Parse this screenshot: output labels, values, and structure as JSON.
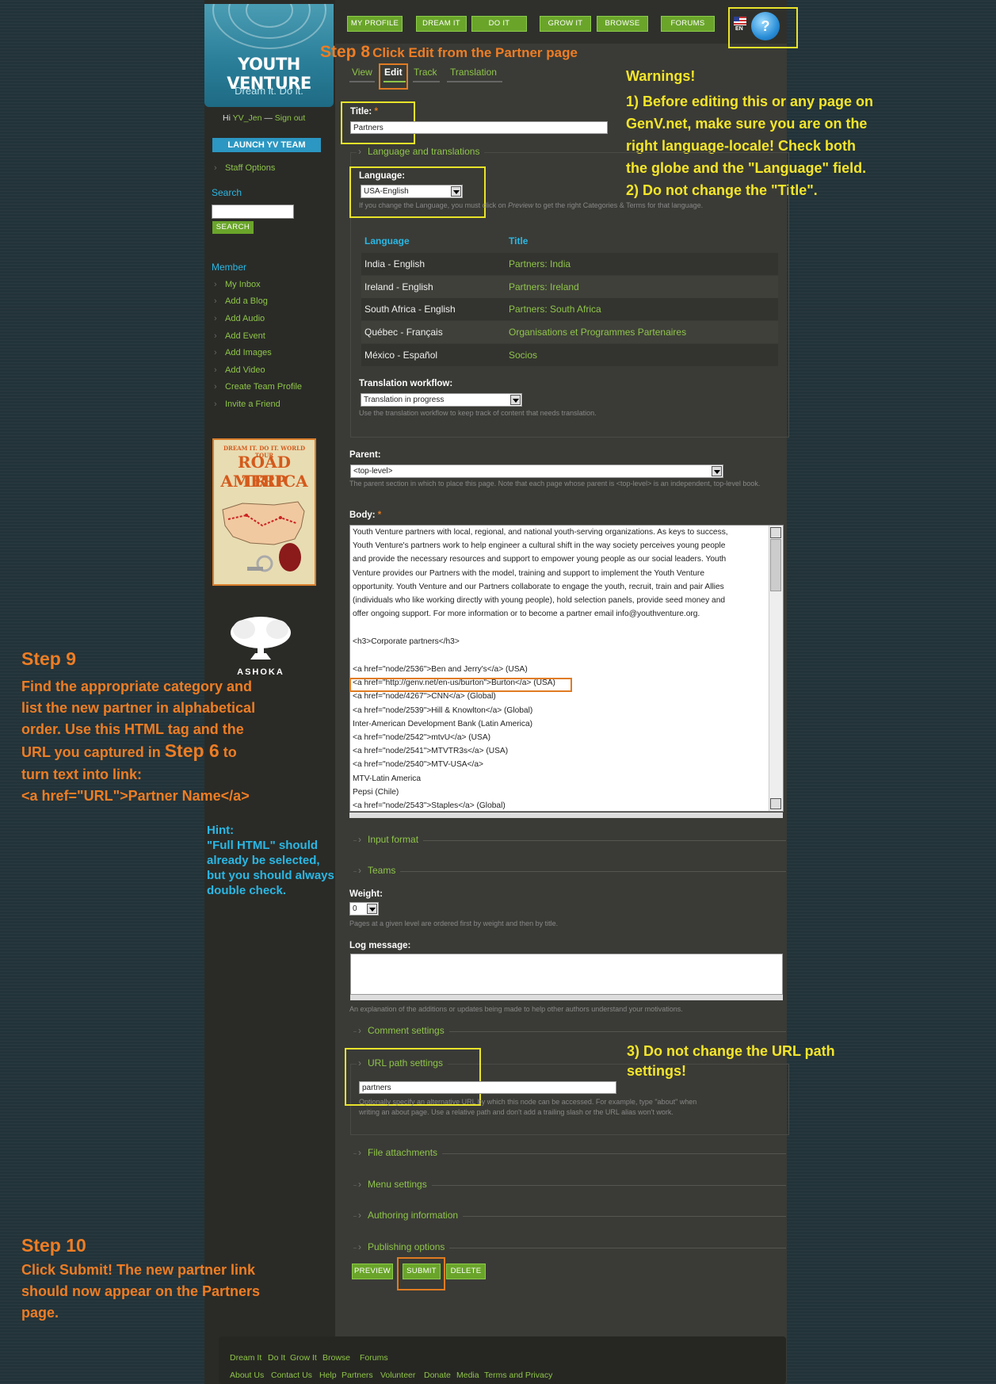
{
  "nav": {
    "buttons": [
      "MY PROFILE",
      "DREAM IT",
      "DO IT",
      "GROW IT",
      "BROWSE",
      "FORUMS"
    ],
    "lang_code": "EN",
    "help_symbol": "?"
  },
  "logo": {
    "title": "YOUTH VENTURE",
    "tagline": "Dream it. Do it."
  },
  "sidebar": {
    "greeting_prefix": "Hi",
    "username": "YV_Jen",
    "separator": "—",
    "signout": "Sign out",
    "launch_label": "LAUNCH YV TEAM",
    "staff_options": "Staff Options",
    "search_heading": "Search",
    "search_button": "SEARCH",
    "member_heading": "Member",
    "member_links": [
      "My Inbox",
      "Add a Blog",
      "Add Audio",
      "Add Event",
      "Add Images",
      "Add Video",
      "Create Team Profile",
      "Invite a Friend"
    ],
    "promo": {
      "top": "DREAM IT. DO IT. WORLD TOUR",
      "line1": "ROAD TRIP",
      "line2": "AMERICA"
    },
    "ashoka": "ASHOKA"
  },
  "tabs": [
    "View",
    "Edit",
    "Track",
    "Translation"
  ],
  "form": {
    "title_label": "Title:",
    "required_mark": "*",
    "title_value": "Partners",
    "lang_fieldset": "Language and translations",
    "language_label": "Language:",
    "language_value": "USA-English",
    "language_hint_a": "If you change the Language, you must click on",
    "language_hint_em": "Preview",
    "language_hint_b": "to get the right Categories & Terms for that language.",
    "translations": {
      "headers": [
        "Language",
        "Title"
      ],
      "rows": [
        [
          "India - English",
          "Partners: India"
        ],
        [
          "Ireland - English",
          "Partners: Ireland"
        ],
        [
          "South Africa - English",
          "Partners: South Africa"
        ],
        [
          "Québec - Français",
          "Organisations et Programmes Partenaires"
        ],
        [
          "México - Español",
          "Socios"
        ]
      ]
    },
    "workflow_label": "Translation workflow:",
    "workflow_value": "Translation in progress",
    "workflow_hint": "Use the translation workflow to keep track of content that needs translation.",
    "parent_label": "Parent:",
    "parent_value": "<top-level>",
    "parent_hint": "The parent section in which to place this page. Note that each page whose parent is <top-level> is an independent, top-level book.",
    "body_label": "Body:",
    "body_lines": [
      "Youth Venture partners with local, regional, and national youth-serving organizations.  As keys to success,",
      "Youth Venture's partners work to help engineer a cultural shift in the way society perceives young people",
      "and provide the necessary resources and support to empower young people as our social leaders.  Youth",
      "Venture provides our Partners with the model, training and support to implement the Youth Venture",
      "opportunity. Youth Venture and our Partners collaborate to engage the youth, recruit, train and pair Allies",
      "(individuals who like working directly with young people), hold selection panels, provide seed money and",
      "offer ongoing support.  For more information or to become a partner email info@youthventure.org.",
      "",
      "<h3>Corporate partners</h3>",
      "",
      "<a href=\"node/2536\">Ben and Jerry's</a> (USA)",
      "<a href=\"http://genv.net/en-us/burton\">Burton</a> (USA)",
      "<a href=\"node/4267\">CNN</a> (Global)",
      "<a href=\"node/2539\">Hill & Knowlton</a> (Global)",
      "Inter-American Development Bank (Latin America)",
      "<a href=\"node/2542\">mtvU</a> (USA)",
      "<a href=\"node/2541\">MTVTR3s</a> (USA)",
      "<a href=\"node/2540\">MTV-USA</a>",
      "MTV-Latin America",
      "Pepsi (Chile)",
      "<a href=\"node/2543\">Staples</a> (Global)"
    ],
    "input_format": "Input format",
    "teams": "Teams",
    "weight_label": "Weight:",
    "weight_value": "0",
    "weight_hint": "Pages at a given level are ordered first by weight and then by title.",
    "log_label": "Log message:",
    "log_value": "",
    "log_hint": "An explanation of the additions or updates being made to help other authors understand your motivations.",
    "comment_settings": "Comment settings",
    "url_fieldset": "URL path settings",
    "url_value": "partners",
    "url_hint_1": "Optionally specify an alternative URL by which this node can be accessed. For example, type \"about\" when",
    "url_hint_2": "writing an about page. Use a relative path and don't add a trailing slash or the URL alias won't work.",
    "collapsed": [
      "File attachments",
      "Menu settings",
      "Authoring information",
      "Publishing options"
    ],
    "buttons": {
      "preview": "PREVIEW",
      "submit": "SUBMIT",
      "delete": "DELETE"
    }
  },
  "annotations": {
    "step8_num": "Step 8",
    "step8_text": "Click Edit from the Partner page",
    "warn_title": "Warnings!",
    "warn_lines": [
      "1) Before editing this or any page on",
      "GenV.net, make sure you are on the",
      "right language-locale! Check both",
      "the globe and the \"Language\" field.",
      "2) Do not change the \"Title\"."
    ],
    "warn3_lines": [
      "3) Do not change the URL path",
      "settings!"
    ],
    "step9_title": "Step 9",
    "step9_lines": [
      "Find the appropriate category and",
      "list the new partner in alphabetical",
      "order. Use this HTML tag and the"
    ],
    "step9_url_a": "URL you captured in",
    "step9_url_step": "Step 6",
    "step9_url_b": "to",
    "step9_tail": [
      "turn text into link:",
      "<a href=\"URL\">Partner Name</a>"
    ],
    "hint_title": "Hint:",
    "hint_lines": [
      "\"Full HTML\" should",
      "already be selected,",
      "but you should always",
      "double check."
    ],
    "step10_title": "Step 10",
    "step10_lines": [
      "Click Submit! The new partner link",
      "should now appear on the Partners",
      "page."
    ]
  },
  "footer": {
    "row1": [
      "Dream It",
      "Do It",
      "Grow It",
      "Browse",
      "Forums"
    ],
    "row2": [
      "About Us",
      "Contact Us",
      "Help",
      "Partners",
      "Volunteer",
      "Donate",
      "Media",
      "Terms and Privacy"
    ]
  },
  "colors": {
    "annotation_orange": "#ee7d24",
    "annotation_yellow": "#f4e52a",
    "hint_cyan": "#2ab7e4",
    "accent_green": "#6aa52a"
  }
}
